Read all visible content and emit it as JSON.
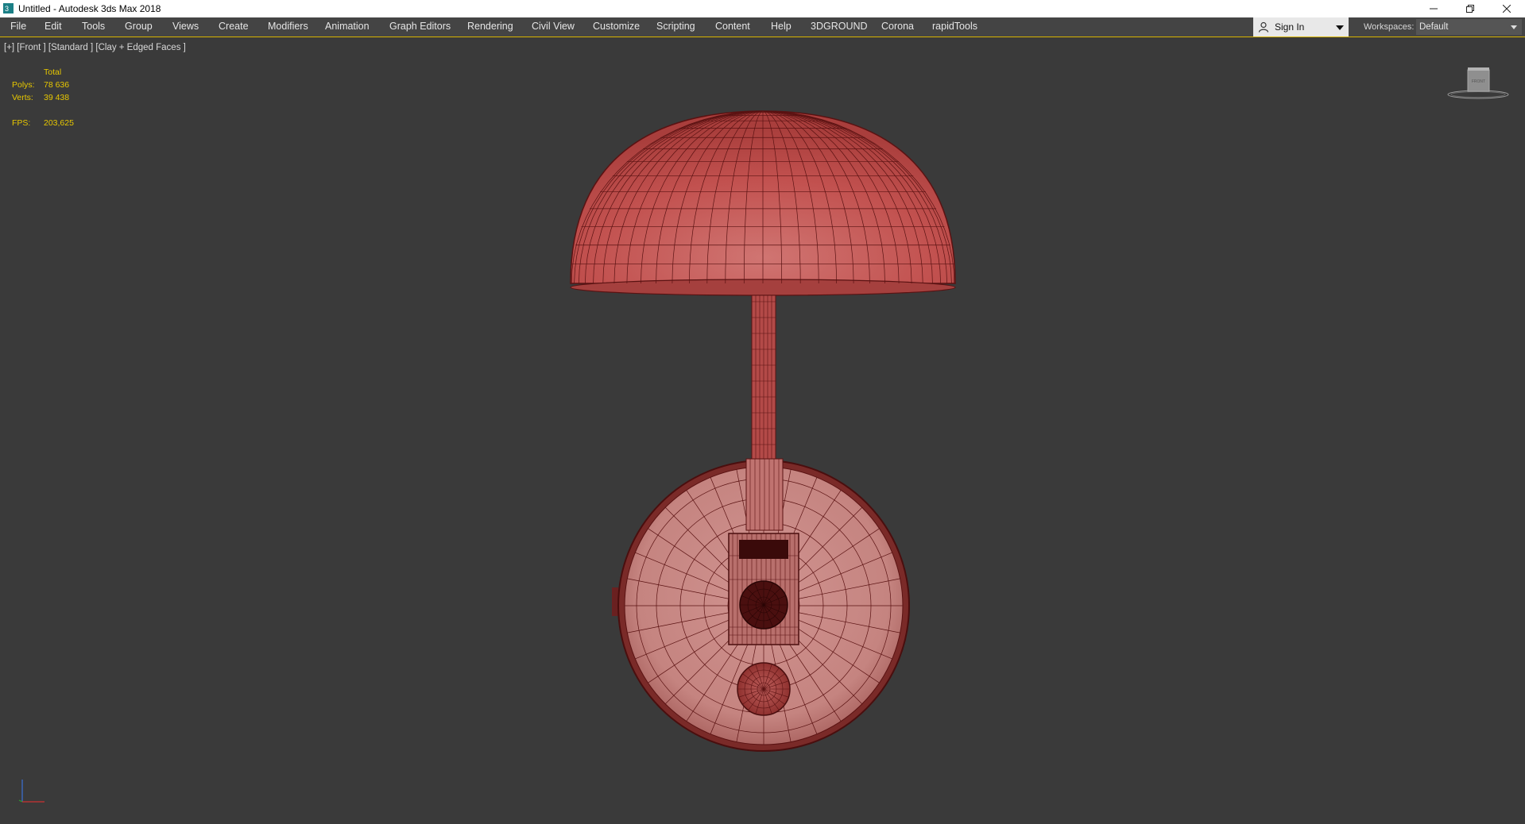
{
  "window": {
    "title": "Untitled - Autodesk 3ds Max 2018",
    "controls": [
      "minimize-icon",
      "restore-icon",
      "close-icon"
    ]
  },
  "menu": {
    "items": [
      "File",
      "Edit",
      "Tools",
      "Group",
      "Views",
      "Create",
      "Modifiers",
      "Animation",
      "Graph Editors",
      "Rendering",
      "Civil View",
      "Customize",
      "Scripting",
      "Content",
      "Help",
      "3DGROUND",
      "Corona",
      "rapidTools"
    ]
  },
  "account": {
    "signin_label": "Sign In"
  },
  "workspaces": {
    "label": "Workspaces:",
    "value": "Default"
  },
  "viewport": {
    "label": "[+] [Front ] [Standard ] [Clay + Edged Faces ]",
    "stats": {
      "header": "Total",
      "polys_label": "Polys:",
      "polys_value": "78 636",
      "verts_label": "Verts:",
      "verts_value": "39 438",
      "fps_label": "FPS:",
      "fps_value": "203,625"
    },
    "viewcube_face": "FRONT"
  },
  "colors": {
    "viewport_bg": "#3a3a3a",
    "menubar_bg": "#444444",
    "stats_text": "#e8c800",
    "model_clay": "#c0504e",
    "wire": "#5a1212"
  }
}
